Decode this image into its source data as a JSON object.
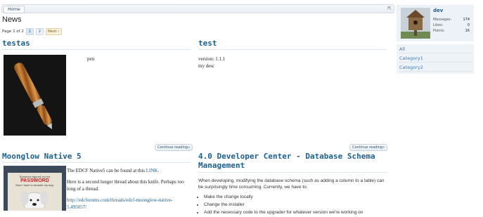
{
  "breadcrumb": {
    "home_label": "Home",
    "jump_icon": "external-link-icon"
  },
  "page": {
    "title": "News"
  },
  "pager": {
    "summary": "Page 1 of 2",
    "pages": [
      "1",
      "2"
    ],
    "current": "1",
    "next_label": "Next ›"
  },
  "posts": [
    {
      "title": "testas",
      "body": "pen",
      "continue_label": "Continue reading»"
    },
    {
      "title": "test",
      "body_line1": "version: 1.1.1",
      "body_line2": "my desc",
      "continue_label": "Continue reading»"
    },
    {
      "title": "Moonglow Native 5",
      "para1_prefix": "The EDCF Native5 can be found at this ",
      "para1_link": "LINK",
      "para1_suffix": ".",
      "para2": "Here is a second longer thread about this knife. Perhaps too long of a thread.",
      "url": "http://edcforums.com/threads/edcf-moonglow-native-5.495057/",
      "image_text_line1": "Someone figured out my",
      "image_text_line2": "PASSWORD",
      "image_text_line3": "Now I have to rename my dog."
    },
    {
      "title": "4.0 Developer Center - Database Schema Management",
      "intro": "When developing, modifying the database schema (such as adding a column to a table) can be surprisingly time consuming. Currently, we have to:",
      "list": [
        "Make the change locally",
        "Change the installer",
        "Add the necessary code to the upgrader for whatever version we're working on"
      ]
    }
  ],
  "user": {
    "name": "dev",
    "stats": [
      {
        "label": "Messages:",
        "value": "174"
      },
      {
        "label": "Likes:",
        "value": "0"
      },
      {
        "label": "Points:",
        "value": "16"
      }
    ]
  },
  "categories": [
    "All",
    "Category1",
    "Category2"
  ]
}
